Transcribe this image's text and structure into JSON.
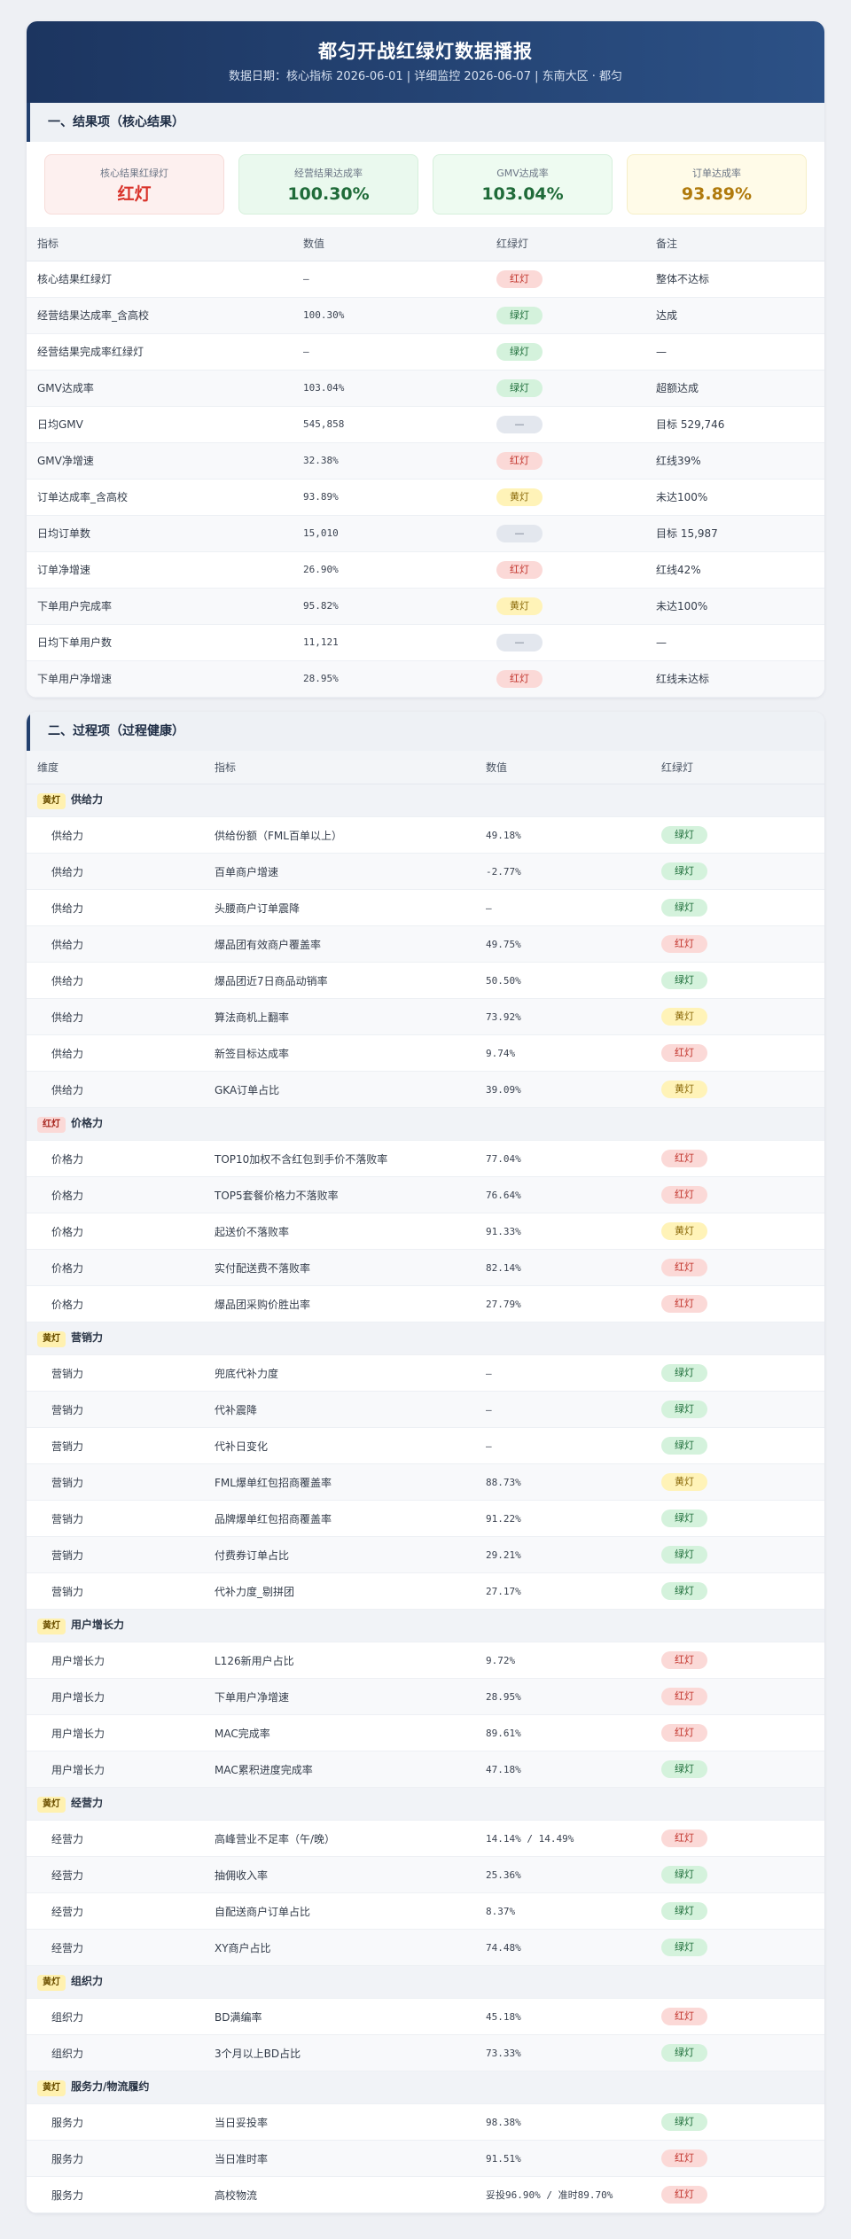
{
  "header": {
    "title": "都匀开战红绿灯数据播报",
    "subtitle": "数据日期：核心指标 2026-06-01 | 详细监控 2026-06-07 | 东南大区 · 都匀"
  },
  "section1": {
    "title": "一、结果项（核心结果）",
    "kpis": [
      {
        "label": "核心结果红绿灯",
        "value": "红灯",
        "tone": "red"
      },
      {
        "label": "经营结果达成率",
        "value": "100.30%",
        "tone": "green1"
      },
      {
        "label": "GMV达成率",
        "value": "103.04%",
        "tone": "green2"
      },
      {
        "label": "订单达成率",
        "value": "93.89%",
        "tone": "yellow"
      }
    ],
    "columns": [
      "指标",
      "数值",
      "红绿灯",
      "备注"
    ],
    "rows": [
      {
        "name": "核心结果红绿灯",
        "value": "—",
        "light": "红灯",
        "tone": "red",
        "note": "整体不达标"
      },
      {
        "name": "经营结果达成率_含高校",
        "value": "100.30%",
        "light": "绿灯",
        "tone": "green",
        "note": "达成"
      },
      {
        "name": "经营结果完成率红绿灯",
        "value": "—",
        "light": "绿灯",
        "tone": "green",
        "note": "—"
      },
      {
        "name": "GMV达成率",
        "value": "103.04%",
        "light": "绿灯",
        "tone": "green",
        "note": "超额达成"
      },
      {
        "name": "日均GMV",
        "value": "545,858",
        "light": "—",
        "tone": "gray",
        "note": "目标 529,746"
      },
      {
        "name": "GMV净增速",
        "value": "32.38%",
        "light": "红灯",
        "tone": "red",
        "note": "红线39%"
      },
      {
        "name": "订单达成率_含高校",
        "value": "93.89%",
        "light": "黄灯",
        "tone": "yellow",
        "note": "未达100%"
      },
      {
        "name": "日均订单数",
        "value": "15,010",
        "light": "—",
        "tone": "gray",
        "note": "目标 15,987"
      },
      {
        "name": "订单净增速",
        "value": "26.90%",
        "light": "红灯",
        "tone": "red",
        "note": "红线42%"
      },
      {
        "name": "下单用户完成率",
        "value": "95.82%",
        "light": "黄灯",
        "tone": "yellow",
        "note": "未达100%"
      },
      {
        "name": "日均下单用户数",
        "value": "11,121",
        "light": "—",
        "tone": "gray",
        "note": "—"
      },
      {
        "name": "下单用户净增速",
        "value": "28.95%",
        "light": "红灯",
        "tone": "red",
        "note": "红线未达标"
      }
    ]
  },
  "section2": {
    "title": "二、过程项（过程健康）",
    "columns": [
      "维度",
      "指标",
      "数值",
      "红绿灯"
    ],
    "groups": [
      {
        "tag": "黄灯",
        "tagTone": "yellow",
        "name": "供给力",
        "rows": [
          {
            "dim": "供给力",
            "name": "供给份额（FML百单以上）",
            "value": "49.18%",
            "light": "绿灯",
            "tone": "green"
          },
          {
            "dim": "供给力",
            "name": "百单商户增速",
            "value": "-2.77%",
            "light": "绿灯",
            "tone": "green"
          },
          {
            "dim": "供给力",
            "name": "头腰商户订单震降",
            "value": "—",
            "light": "绿灯",
            "tone": "green"
          },
          {
            "dim": "供给力",
            "name": "爆品团有效商户覆盖率",
            "value": "49.75%",
            "light": "红灯",
            "tone": "red"
          },
          {
            "dim": "供给力",
            "name": "爆品团近7日商品动销率",
            "value": "50.50%",
            "light": "绿灯",
            "tone": "green"
          },
          {
            "dim": "供给力",
            "name": "算法商机上翻率",
            "value": "73.92%",
            "light": "黄灯",
            "tone": "yellow"
          },
          {
            "dim": "供给力",
            "name": "新签目标达成率",
            "value": "9.74%",
            "light": "红灯",
            "tone": "red"
          },
          {
            "dim": "供给力",
            "name": "GKA订单占比",
            "value": "39.09%",
            "light": "黄灯",
            "tone": "yellow"
          }
        ]
      },
      {
        "tag": "红灯",
        "tagTone": "red",
        "name": "价格力",
        "rows": [
          {
            "dim": "价格力",
            "name": "TOP10加权不含红包到手价不落败率",
            "value": "77.04%",
            "light": "红灯",
            "tone": "red"
          },
          {
            "dim": "价格力",
            "name": "TOP5套餐价格力不落败率",
            "value": "76.64%",
            "light": "红灯",
            "tone": "red"
          },
          {
            "dim": "价格力",
            "name": "起送价不落败率",
            "value": "91.33%",
            "light": "黄灯",
            "tone": "yellow"
          },
          {
            "dim": "价格力",
            "name": "实付配送费不落败率",
            "value": "82.14%",
            "light": "红灯",
            "tone": "red"
          },
          {
            "dim": "价格力",
            "name": "爆品团采购价胜出率",
            "value": "27.79%",
            "light": "红灯",
            "tone": "red"
          }
        ]
      },
      {
        "tag": "黄灯",
        "tagTone": "yellow",
        "name": "营销力",
        "rows": [
          {
            "dim": "营销力",
            "name": "兜底代补力度",
            "value": "—",
            "light": "绿灯",
            "tone": "green"
          },
          {
            "dim": "营销力",
            "name": "代补震降",
            "value": "—",
            "light": "绿灯",
            "tone": "green"
          },
          {
            "dim": "营销力",
            "name": "代补日变化",
            "value": "—",
            "light": "绿灯",
            "tone": "green"
          },
          {
            "dim": "营销力",
            "name": "FML爆单红包招商覆盖率",
            "value": "88.73%",
            "light": "黄灯",
            "tone": "yellow"
          },
          {
            "dim": "营销力",
            "name": "品牌爆单红包招商覆盖率",
            "value": "91.22%",
            "light": "绿灯",
            "tone": "green"
          },
          {
            "dim": "营销力",
            "name": "付费券订单占比",
            "value": "29.21%",
            "light": "绿灯",
            "tone": "green"
          },
          {
            "dim": "营销力",
            "name": "代补力度_剔拼团",
            "value": "27.17%",
            "light": "绿灯",
            "tone": "green"
          }
        ]
      },
      {
        "tag": "黄灯",
        "tagTone": "yellow",
        "name": "用户增长力",
        "rows": [
          {
            "dim": "用户增长力",
            "name": "L126新用户占比",
            "value": "9.72%",
            "light": "红灯",
            "tone": "red"
          },
          {
            "dim": "用户增长力",
            "name": "下单用户净增速",
            "value": "28.95%",
            "light": "红灯",
            "tone": "red"
          },
          {
            "dim": "用户增长力",
            "name": "MAC完成率",
            "value": "89.61%",
            "light": "红灯",
            "tone": "red"
          },
          {
            "dim": "用户增长力",
            "name": "MAC累积进度完成率",
            "value": "47.18%",
            "light": "绿灯",
            "tone": "green"
          }
        ]
      },
      {
        "tag": "黄灯",
        "tagTone": "yellow",
        "name": "经营力",
        "rows": [
          {
            "dim": "经营力",
            "name": "高峰营业不足率（午/晚）",
            "value": "14.14% / 14.49%",
            "light": "红灯",
            "tone": "red"
          },
          {
            "dim": "经营力",
            "name": "抽佣收入率",
            "value": "25.36%",
            "light": "绿灯",
            "tone": "green"
          },
          {
            "dim": "经营力",
            "name": "自配送商户订单占比",
            "value": "8.37%",
            "light": "绿灯",
            "tone": "green"
          },
          {
            "dim": "经营力",
            "name": "XY商户占比",
            "value": "74.48%",
            "light": "绿灯",
            "tone": "green"
          }
        ]
      },
      {
        "tag": "黄灯",
        "tagTone": "yellow",
        "name": "组织力",
        "rows": [
          {
            "dim": "组织力",
            "name": "BD满编率",
            "value": "45.18%",
            "light": "红灯",
            "tone": "red"
          },
          {
            "dim": "组织力",
            "name": "3个月以上BD占比",
            "value": "73.33%",
            "light": "绿灯",
            "tone": "green"
          }
        ]
      },
      {
        "tag": "黄灯",
        "tagTone": "yellow",
        "name": "服务力/物流履约",
        "rows": [
          {
            "dim": "服务力",
            "name": "当日妥投率",
            "value": "98.38%",
            "light": "绿灯",
            "tone": "green"
          },
          {
            "dim": "服务力",
            "name": "当日准时率",
            "value": "91.51%",
            "light": "红灯",
            "tone": "red"
          },
          {
            "dim": "服务力",
            "name": "高校物流",
            "value": "妥投96.90% / 准时89.70%",
            "light": "红灯",
            "tone": "red"
          }
        ]
      }
    ]
  }
}
